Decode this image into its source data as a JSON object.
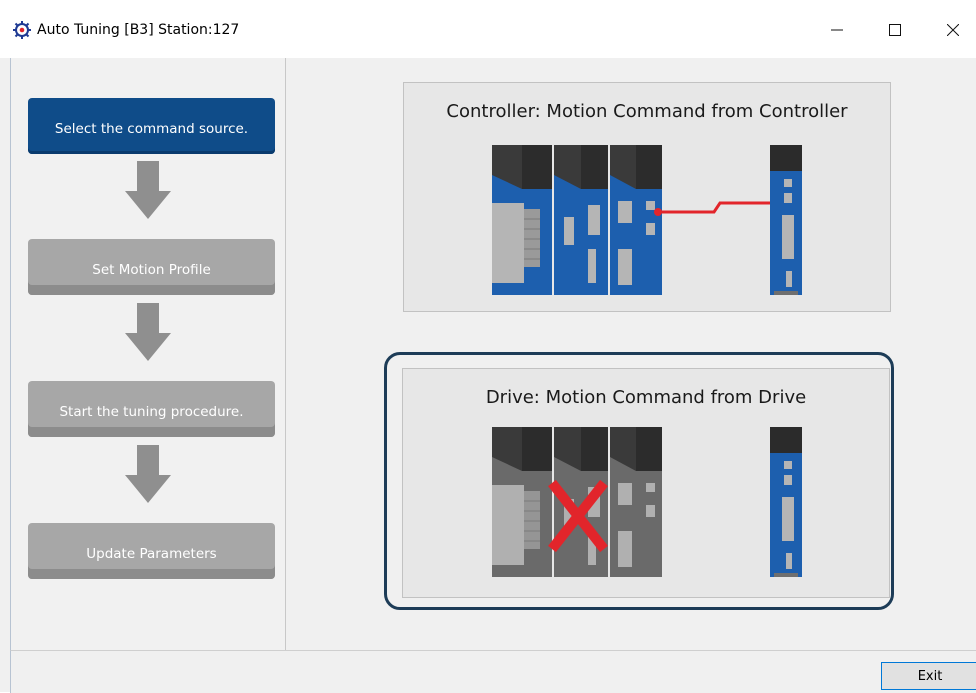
{
  "window": {
    "title": "Auto Tuning [B3] Station:127",
    "icon": "gear-icon",
    "controls": {
      "minimize": "minimize-icon",
      "maximize": "maximize-icon",
      "close": "close-icon"
    }
  },
  "steps": [
    {
      "label": "Select the command source.",
      "state": "active"
    },
    {
      "label": "Set Motion Profile",
      "state": "inactive"
    },
    {
      "label": "Start the tuning procedure.",
      "state": "inactive"
    },
    {
      "label": "Update Parameters",
      "state": "inactive"
    }
  ],
  "options": [
    {
      "title": "Controller: Motion Command from Controller",
      "selected": false,
      "disabled_mark": false
    },
    {
      "title": "Drive: Motion Command from Drive",
      "selected": true,
      "disabled_mark": true
    }
  ],
  "footer": {
    "exit_label": "Exit"
  },
  "colors": {
    "active_step": "#0f4c89",
    "inactive_step": "#a7a7a7",
    "module_blue": "#1d5fae",
    "link_red": "#e2252b",
    "selection_border": "#1d3c57"
  }
}
